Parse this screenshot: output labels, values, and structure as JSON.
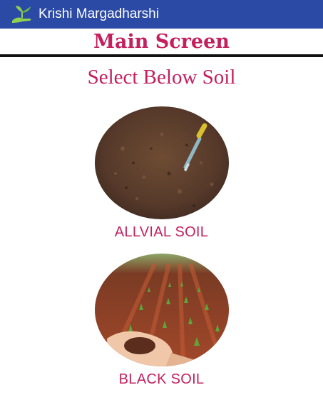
{
  "app": {
    "title": "Krishi Margadharshi",
    "logo_icon": "sprout-hand-icon",
    "bar_color": "#2b4aa6"
  },
  "screen": {
    "title": "Main Screen",
    "prompt": "Select Below Soil",
    "accent_color": "#c4205e"
  },
  "soils": [
    {
      "label": "ALLVIAL SOIL",
      "image": "alluvial-soil-with-trowel"
    },
    {
      "label": "BLACK SOIL",
      "image": "red-soil-field-with-seedlings"
    }
  ]
}
